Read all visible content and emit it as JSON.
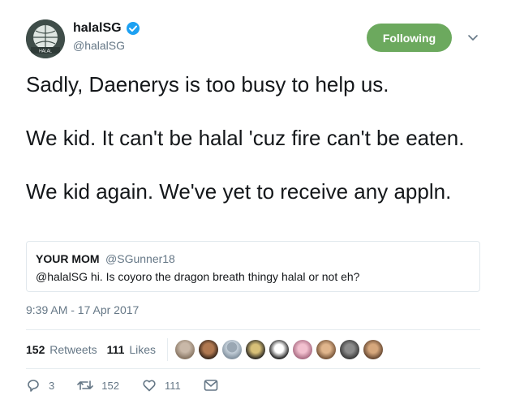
{
  "author": {
    "display_name": "halalSG",
    "handle": "@halalSG",
    "avatar_icon": "halal-logo-avatar",
    "avatar_text": "HALAL",
    "verified_icon": "verified-badge-icon"
  },
  "follow_button": {
    "label": "Following",
    "color": "#6ca95e"
  },
  "menu_icon": "chevron-down-icon",
  "tweet": {
    "paragraphs": [
      "Sadly, Daenerys is too busy to help us.",
      "We kid. It can't be halal 'cuz fire can't be eaten.",
      "We kid again. We've yet to receive any appln."
    ]
  },
  "quoted_tweet": {
    "name": "YOUR MOM",
    "handle": "@SGunner18",
    "text": "@halalSG  hi. Is coyoro the dragon breath thingy halal or not eh?"
  },
  "timestamp": "9:39 AM - 17 Apr 2017",
  "stats": {
    "retweets_count": "152",
    "retweets_label": "Retweets",
    "likes_count": "111",
    "likes_label": "Likes",
    "liker_avatars": 9
  },
  "actions": {
    "reply_count": "3",
    "retweet_count": "152",
    "like_count": "111",
    "reply_icon": "reply-icon",
    "retweet_icon": "retweet-icon",
    "like_icon": "heart-icon",
    "dm_icon": "direct-message-icon"
  },
  "colors": {
    "text": "#14171a",
    "secondary": "#657786",
    "verified": "#1da1f2",
    "divider": "#e6ecf0"
  }
}
